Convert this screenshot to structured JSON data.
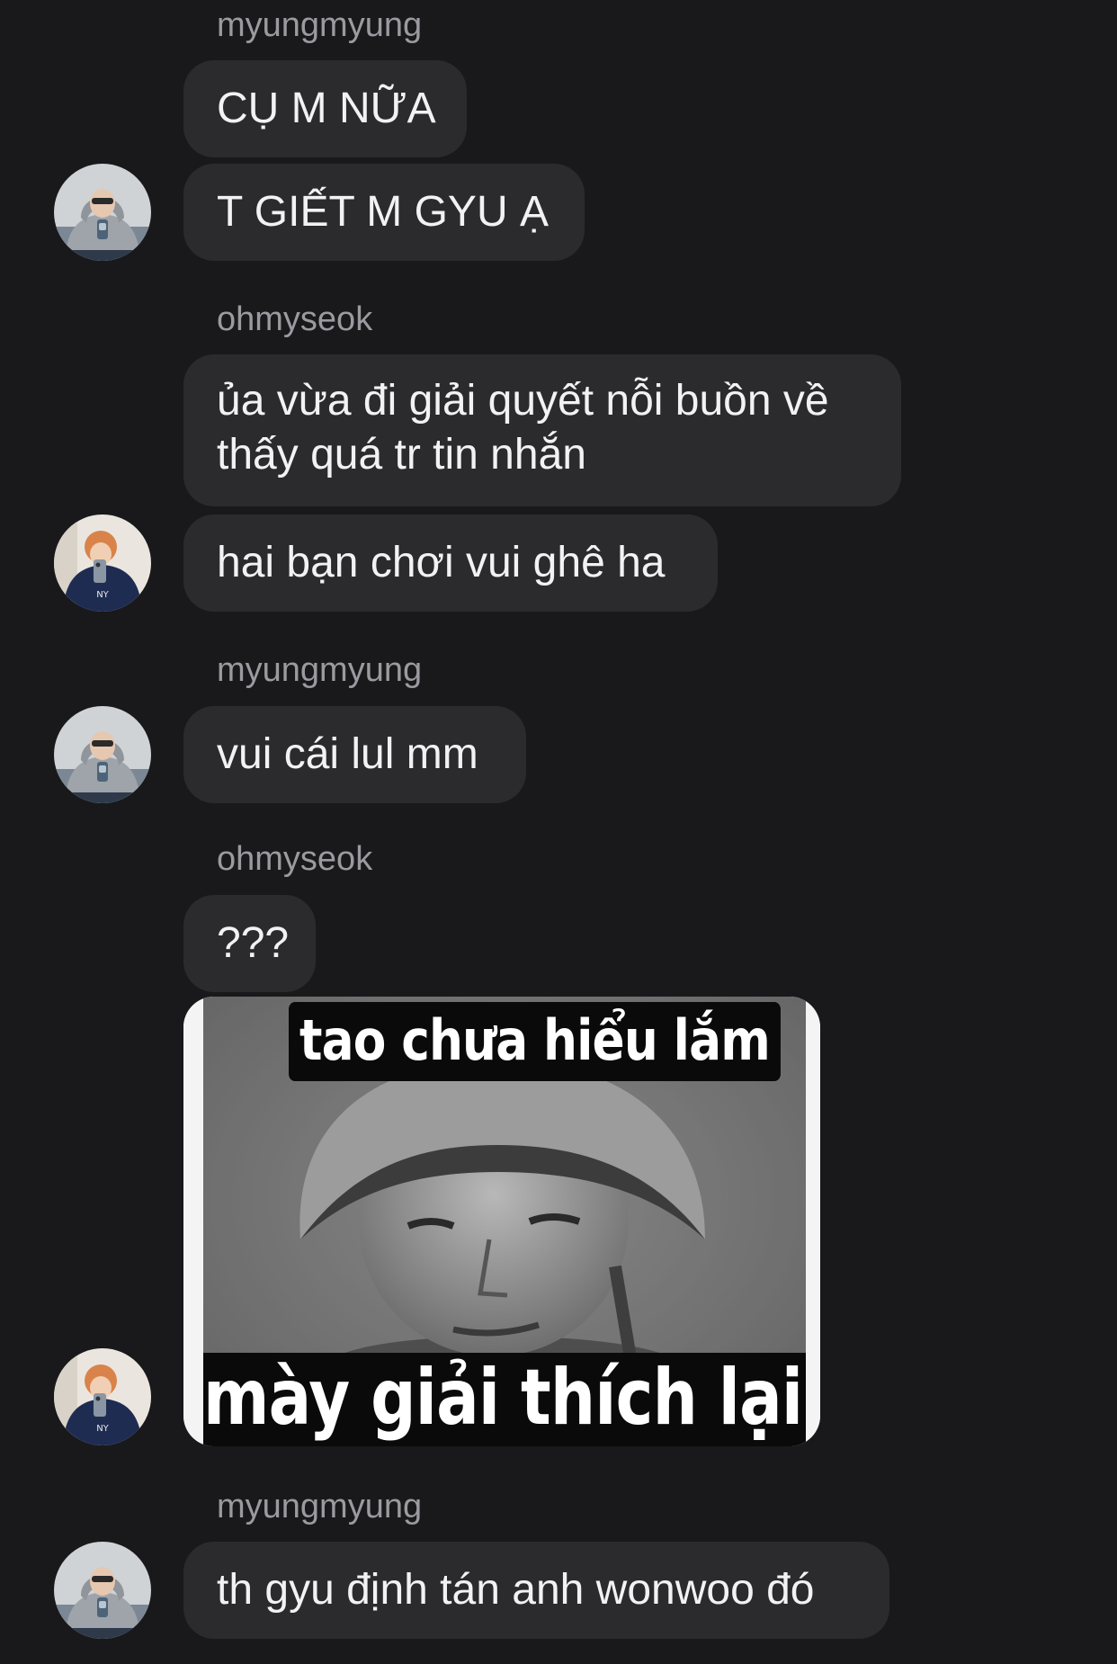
{
  "thread": {
    "messages": [
      {
        "sender": "myungmyung",
        "texts": [
          "CỤ M NỮA",
          "T GIẾT M GYU Ạ"
        ]
      },
      {
        "sender": "ohmyseok",
        "texts": [
          "ủa vừa đi giải quyết nỗi buồn về thấy quá tr tin nhắn",
          "hai bạn chơi vui ghê ha"
        ]
      },
      {
        "sender": "myungmyung",
        "texts": [
          "vui cái lul mm"
        ]
      },
      {
        "sender": "ohmyseok",
        "texts": [
          "???"
        ],
        "meme": {
          "top_caption": "tao chưa hiểu lắm",
          "bottom_caption": "mày giải thích lại đi"
        }
      },
      {
        "sender": "myungmyung",
        "texts": [
          "th gyu định tán anh wonwoo đó"
        ]
      }
    ]
  },
  "colors": {
    "background": "#19191b",
    "bubble": "#2b2b2e",
    "text": "#f2f2f4",
    "sender_name": "#9a9aa0"
  },
  "icons": {
    "avatar_myungmyung": "avatar-grey-hoodie-icon",
    "avatar_ohmyseok": "avatar-navy-hoodie-icon"
  }
}
